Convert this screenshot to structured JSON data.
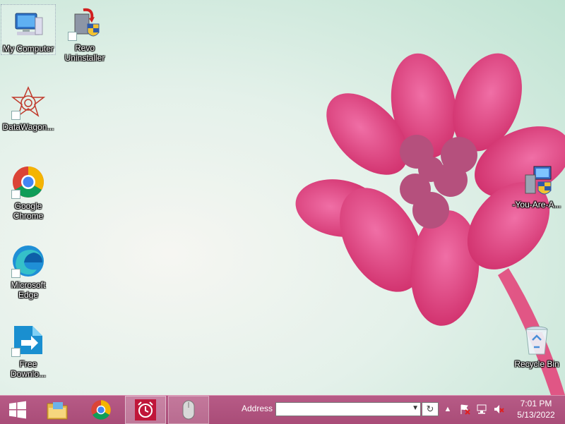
{
  "desktop": {
    "icons": [
      {
        "label": "My Computer"
      },
      {
        "label": "Revo Uninstaller"
      },
      {
        "label": "DataWagon..."
      },
      {
        "label": "Google Chrome"
      },
      {
        "label": "Microsoft Edge"
      },
      {
        "label": "Free Downlo..."
      },
      {
        "label": "-You-Are-A..."
      },
      {
        "label": "Recycle Bin"
      }
    ]
  },
  "taskbar": {
    "address_label": "Address",
    "address_value": "",
    "clock_time": "7:01 PM",
    "clock_date": "5/13/2022"
  },
  "colors": {
    "taskbar": "#a94c78",
    "flower": "#e0407e"
  }
}
